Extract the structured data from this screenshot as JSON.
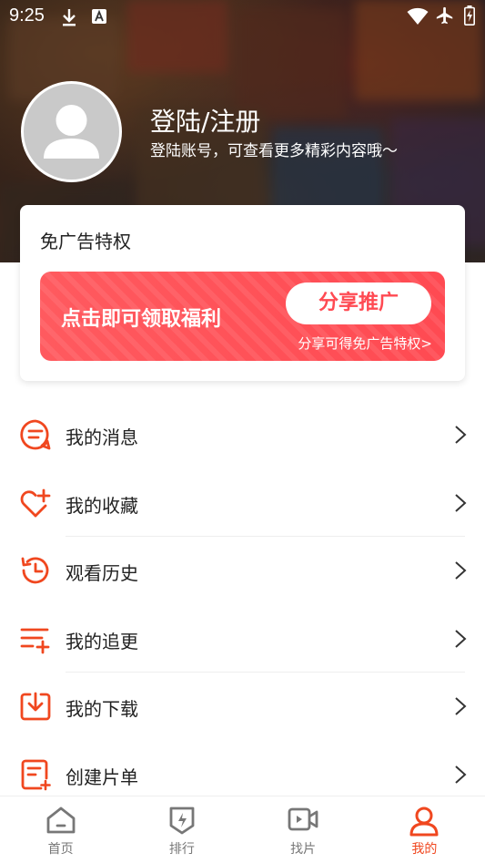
{
  "status_bar": {
    "time": "9:25"
  },
  "profile": {
    "title": "登陆/注册",
    "subtitle": "登陆账号，可查看更多精彩内容哦～"
  },
  "ad_free_card": {
    "title": "免广告特权",
    "banner_text": "点击即可领取福利",
    "share_button": "分享推广",
    "share_subtext": "分享可得免广告特权>"
  },
  "menu": {
    "items": [
      {
        "label": "我的消息",
        "icon": "message-icon"
      },
      {
        "label": "我的收藏",
        "icon": "heart-plus-icon"
      },
      {
        "label": "观看历史",
        "icon": "history-icon"
      },
      {
        "label": "我的追更",
        "icon": "list-add-icon"
      },
      {
        "label": "我的下载",
        "icon": "download-icon"
      },
      {
        "label": "创建片单",
        "icon": "create-list-icon"
      }
    ]
  },
  "tabbar": {
    "tabs": [
      {
        "label": "首页",
        "icon": "home-icon",
        "active": false
      },
      {
        "label": "排行",
        "icon": "ranking-icon",
        "active": false
      },
      {
        "label": "找片",
        "icon": "video-icon",
        "active": false
      },
      {
        "label": "我的",
        "icon": "user-icon",
        "active": true
      }
    ],
    "accent_color": "#f0471f",
    "inactive_color": "#777777"
  },
  "colors": {
    "accent": "#f0471f",
    "banner_red": "#ff4a52"
  }
}
